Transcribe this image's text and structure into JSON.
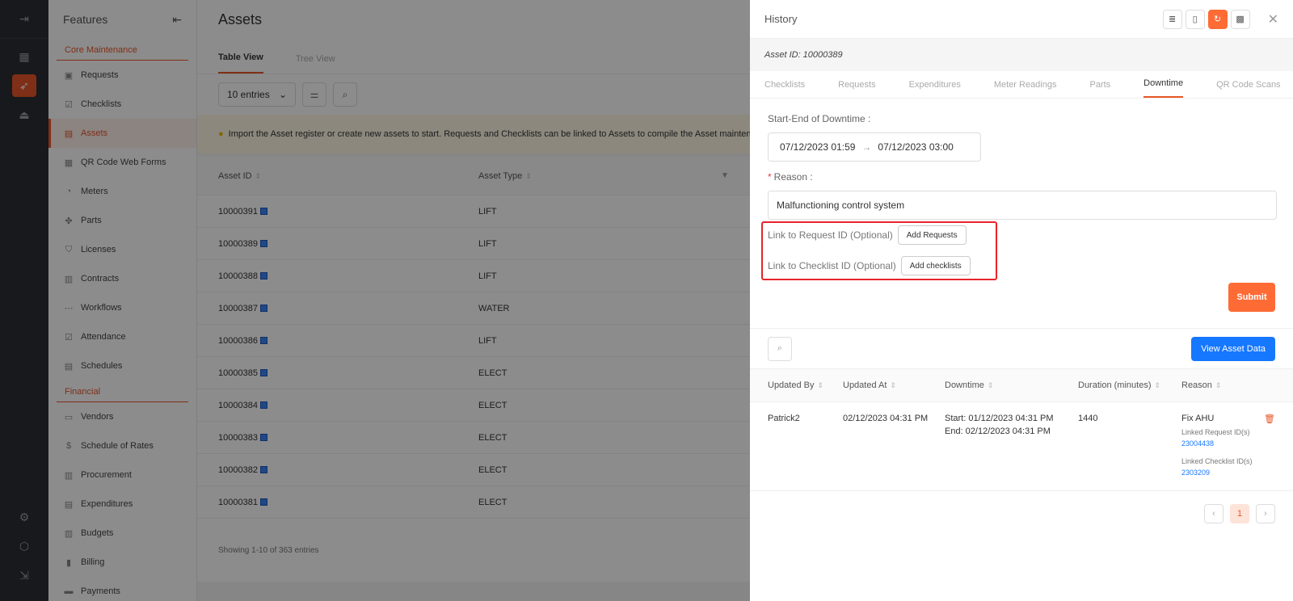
{
  "rail": {
    "icons": [
      "menu-toggle-icon",
      "dashboard-icon",
      "rocket-icon",
      "org-chart-icon",
      "settings-icon",
      "cube-icon",
      "logout-icon"
    ]
  },
  "features": {
    "title": "Features",
    "section_core": "Core Maintenance",
    "core_items": [
      "Requests",
      "Checklists",
      "Assets",
      "QR Code Web Forms",
      "Meters",
      "Parts",
      "Licenses",
      "Contracts",
      "Workflows",
      "Attendance",
      "Schedules"
    ],
    "section_financial": "Financial",
    "financial_items": [
      "Vendors",
      "Schedule of Rates",
      "Procurement",
      "Expenditures",
      "Budgets",
      "Billing",
      "Payments"
    ],
    "active_item": "Assets"
  },
  "main": {
    "title": "Assets",
    "tabs": [
      "Table View",
      "Tree View"
    ],
    "entries": "10 entries",
    "notice": "Import the Asset register or create new assets to start. Requests and Checklists can be linked to Assets to compile the Asset maintenance h",
    "columns": [
      "Asset ID",
      "Asset Type"
    ],
    "rows": [
      {
        "id": "10000391",
        "type": "LIFT"
      },
      {
        "id": "10000389",
        "type": "LIFT"
      },
      {
        "id": "10000388",
        "type": "LIFT"
      },
      {
        "id": "10000387",
        "type": "WATER"
      },
      {
        "id": "10000386",
        "type": "LIFT"
      },
      {
        "id": "10000385",
        "type": "ELECT"
      },
      {
        "id": "10000384",
        "type": "ELECT"
      },
      {
        "id": "10000383",
        "type": "ELECT"
      },
      {
        "id": "10000382",
        "type": "ELECT"
      },
      {
        "id": "10000381",
        "type": "ELECT"
      }
    ],
    "footer": "Showing 1-10 of 363 entries"
  },
  "drawer": {
    "title": "History",
    "asset_id": "Asset ID: 10000389",
    "tabs": [
      "Checklists",
      "Requests",
      "Expenditures",
      "Meter Readings",
      "Parts",
      "Downtime",
      "QR Code Scans"
    ],
    "active_tab": "Downtime",
    "form": {
      "downtime_label": "Start-End of Downtime :",
      "date_start": "07/12/2023 01:59",
      "date_sep": "→",
      "date_end": "07/12/2023 03:00",
      "reason_label": "Reason :",
      "reason_value": "Malfunctioning control system",
      "link_request_label": "Link to Request ID (Optional)",
      "add_requests": "Add Requests",
      "link_checklist_label": "Link to Checklist ID (Optional)",
      "add_checklists": "Add checklists",
      "submit": "Submit"
    },
    "view_asset_data": "View Asset Data",
    "history_columns": [
      "Updated By",
      "Updated At",
      "Downtime",
      "Duration (minutes)",
      "Reason"
    ],
    "history_rows": [
      {
        "updated_by": "Patrick2",
        "updated_at": "02/12/2023 04:31 PM",
        "start": "Start: 01/12/2023 04:31 PM",
        "end": "End: 02/12/2023 04:31 PM",
        "duration": "1440",
        "reason": "Fix AHU",
        "linked_request_label": "Linked Request ID(s)",
        "linked_request": "23004438",
        "linked_checklist_label": "Linked Checklist ID(s)",
        "linked_checklist": "2303209"
      }
    ],
    "page": "1"
  },
  "colors": {
    "accent": "#e8572a",
    "primary": "#1677ff",
    "highlight_box": "#e8232a"
  }
}
